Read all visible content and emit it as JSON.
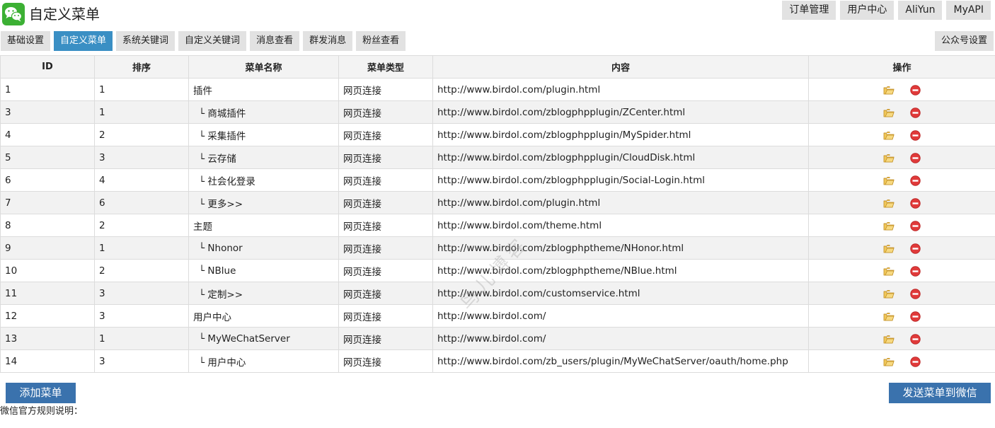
{
  "header": {
    "title": "自定义菜单",
    "top_links": [
      "订单管理",
      "用户中心",
      "AliYun",
      "MyAPI"
    ]
  },
  "tabs": [
    {
      "label": "基础设置",
      "active": false
    },
    {
      "label": "自定义菜单",
      "active": true
    },
    {
      "label": "系统关键词",
      "active": false
    },
    {
      "label": "自定义关键词",
      "active": false
    },
    {
      "label": "消息查看",
      "active": false
    },
    {
      "label": "群发消息",
      "active": false
    },
    {
      "label": "粉丝查看",
      "active": false
    }
  ],
  "settings_tab": "公众号设置",
  "table": {
    "columns": [
      "ID",
      "排序",
      "菜单名称",
      "菜单类型",
      "内容",
      "操作"
    ],
    "rows": [
      {
        "id": "1",
        "order": "1",
        "name": "插件",
        "type": "网页连接",
        "content": "http://www.birdol.com/plugin.html"
      },
      {
        "id": "3",
        "order": "1",
        "name": "└ 商城插件",
        "type": "网页连接",
        "content": "http://www.birdol.com/zblogphpplugin/ZCenter.html"
      },
      {
        "id": "4",
        "order": "2",
        "name": "└ 采集插件",
        "type": "网页连接",
        "content": "http://www.birdol.com/zblogphpplugin/MySpider.html"
      },
      {
        "id": "5",
        "order": "3",
        "name": "└ 云存储",
        "type": "网页连接",
        "content": "http://www.birdol.com/zblogphpplugin/CloudDisk.html"
      },
      {
        "id": "6",
        "order": "4",
        "name": "└ 社会化登录",
        "type": "网页连接",
        "content": "http://www.birdol.com/zblogphpplugin/Social-Login.html"
      },
      {
        "id": "7",
        "order": "6",
        "name": "└ 更多>>",
        "type": "网页连接",
        "content": "http://www.birdol.com/plugin.html"
      },
      {
        "id": "8",
        "order": "2",
        "name": "主题",
        "type": "网页连接",
        "content": "http://www.birdol.com/theme.html"
      },
      {
        "id": "9",
        "order": "1",
        "name": "└ Nhonor",
        "type": "网页连接",
        "content": "http://www.birdol.com/zblogphptheme/NHonor.html"
      },
      {
        "id": "10",
        "order": "2",
        "name": "└ NBlue",
        "type": "网页连接",
        "content": "http://www.birdol.com/zblogphptheme/NBlue.html"
      },
      {
        "id": "11",
        "order": "3",
        "name": "└ 定制>>",
        "type": "网页连接",
        "content": "http://www.birdol.com/customservice.html"
      },
      {
        "id": "12",
        "order": "3",
        "name": "用户中心",
        "type": "网页连接",
        "content": "http://www.birdol.com/"
      },
      {
        "id": "13",
        "order": "1",
        "name": "└ MyWeChatServer",
        "type": "网页连接",
        "content": "http://www.birdol.com/"
      },
      {
        "id": "14",
        "order": "3",
        "name": "└ 用户中心",
        "type": "网页连接",
        "content": "http://www.birdol.com/zb_users/plugin/MyWeChatServer/oauth/home.php"
      }
    ]
  },
  "buttons": {
    "add_menu": "添加菜单",
    "send_menu": "发送菜单到微信"
  },
  "rules_text": "微信官方规则说明：",
  "watermark": "鸟儿博客",
  "icons": {
    "logo": "wechat-logo-icon",
    "edit": "folder-edit-icon",
    "delete": "delete-circle-icon"
  },
  "colors": {
    "active_tab": "#3a8fc4",
    "button_blue": "#3a72ad",
    "logo_green": "#3cb034",
    "delete_red": "#e03a3a",
    "folder_yellow": "#e8b23a"
  }
}
